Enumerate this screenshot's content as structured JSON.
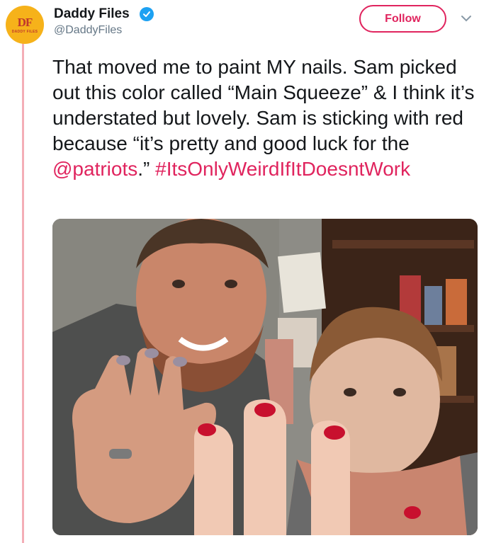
{
  "author": {
    "name": "Daddy Files",
    "handle": "@DaddyFiles",
    "avatar_monogram": "DF",
    "avatar_subtext": "DADDY FILES",
    "verified": true
  },
  "follow_label": "Follow",
  "tweet": {
    "text_before": "That moved me to paint MY nails. Sam picked out this color called “Main Squeeze” & I think it’s understated but lovely. Sam is sticking with red because “it’s pretty and good luck for the ",
    "mention": "@patriots",
    "text_after": ".” ",
    "hashtag": "#ItsOnlyWeirdIfItDoesntWork"
  },
  "colors": {
    "accent": "#e0245e",
    "verified": "#1da1f2",
    "thread_line": "#f4aeb7",
    "avatar_bg": "#f6b21a",
    "text": "#14171a",
    "muted": "#657786"
  },
  "icons": {
    "verified": "verified-badge-icon",
    "caret": "chevron-down-icon"
  }
}
